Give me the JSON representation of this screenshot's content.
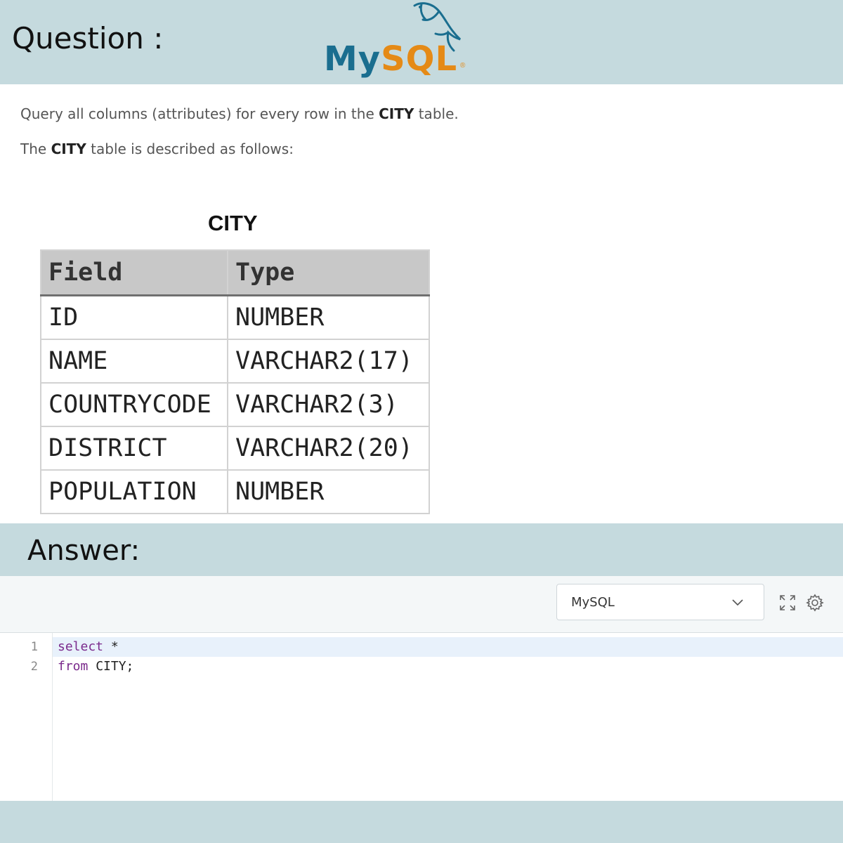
{
  "question_header": {
    "title": "Question :"
  },
  "logo": {
    "my": "My",
    "sql": "SQL",
    "reg": "®"
  },
  "question": {
    "line1": {
      "pre": "Query all columns (attributes) for every row in the ",
      "bold": "CITY",
      "post": " table."
    },
    "line2": {
      "pre": "The ",
      "bold": "CITY",
      "post": " table is described as follows:"
    },
    "table_caption": "CITY",
    "table": {
      "headers": [
        "Field",
        "Type"
      ],
      "rows": [
        [
          "ID",
          "NUMBER"
        ],
        [
          "NAME",
          "VARCHAR2(17)"
        ],
        [
          "COUNTRYCODE",
          "VARCHAR2(3)"
        ],
        [
          "DISTRICT",
          "VARCHAR2(20)"
        ],
        [
          "POPULATION",
          "NUMBER"
        ]
      ]
    }
  },
  "answer_header": {
    "title": "Answer:"
  },
  "editor": {
    "language": "MySQL",
    "icons": [
      "expand-icon",
      "gear-icon"
    ],
    "lines": [
      {
        "number": "1",
        "keyword": "select",
        "rest": " *"
      },
      {
        "number": "2",
        "keyword": "from",
        "rest": " CITY;"
      }
    ]
  },
  "colors": {
    "band": "#c5dade",
    "keyword": "#7a2a8c",
    "logo_blue": "#1a6e8f",
    "logo_orange": "#e58a16"
  }
}
